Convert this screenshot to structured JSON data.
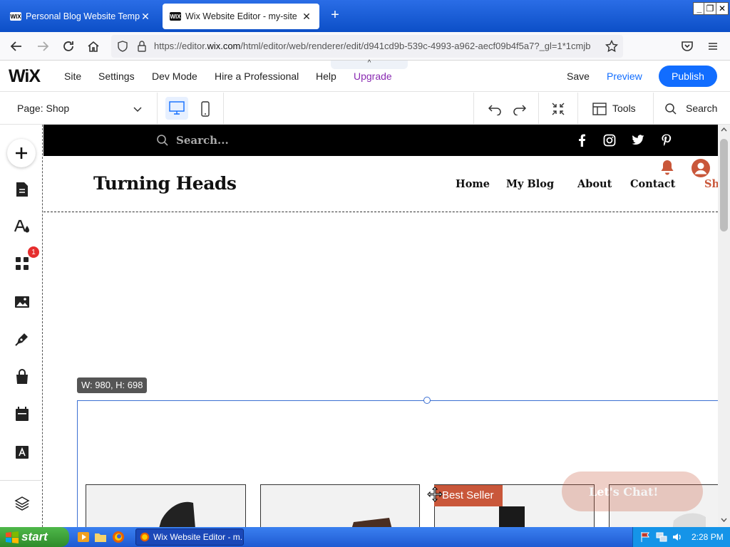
{
  "browser": {
    "tabs": [
      {
        "favicon": "WIX",
        "title": "Personal Blog Website Templates |",
        "close": "✕"
      },
      {
        "favicon": "WIX",
        "title": "Wix Website Editor - my-site",
        "close": "✕"
      }
    ],
    "new_tab": "+",
    "url": {
      "prefix": "https://editor.",
      "domain": "wix.com",
      "path": "/html/editor/web/renderer/edit/d941cd9b-539c-4993-a962-aecf09b4f5a7?_gl=1*1cmjb"
    }
  },
  "wix": {
    "logo": "WiX",
    "menu": [
      "Site",
      "Settings",
      "Dev Mode",
      "Hire a Professional",
      "Help",
      "Upgrade"
    ],
    "save": "Save",
    "preview": "Preview",
    "publish": "Publish",
    "pulltab": "^"
  },
  "toolbar": {
    "page_label": "Page:",
    "page_value": "Shop",
    "tools": "Tools",
    "search": "Search"
  },
  "sidebar": {
    "badge": "1"
  },
  "site": {
    "search_placeholder": "Search...",
    "title": "Turning Heads",
    "nav": [
      "Home",
      "My Blog",
      "About",
      "Contact",
      "Sh"
    ],
    "accent_color": "#c9573a",
    "best_seller": "Best Seller",
    "chat": "Let's Chat!"
  },
  "editor": {
    "dimensions": "W: 980, H: 698"
  },
  "taskbar": {
    "start": "start",
    "task": "Wix Website Editor - m...",
    "clock": "2:28 PM"
  }
}
